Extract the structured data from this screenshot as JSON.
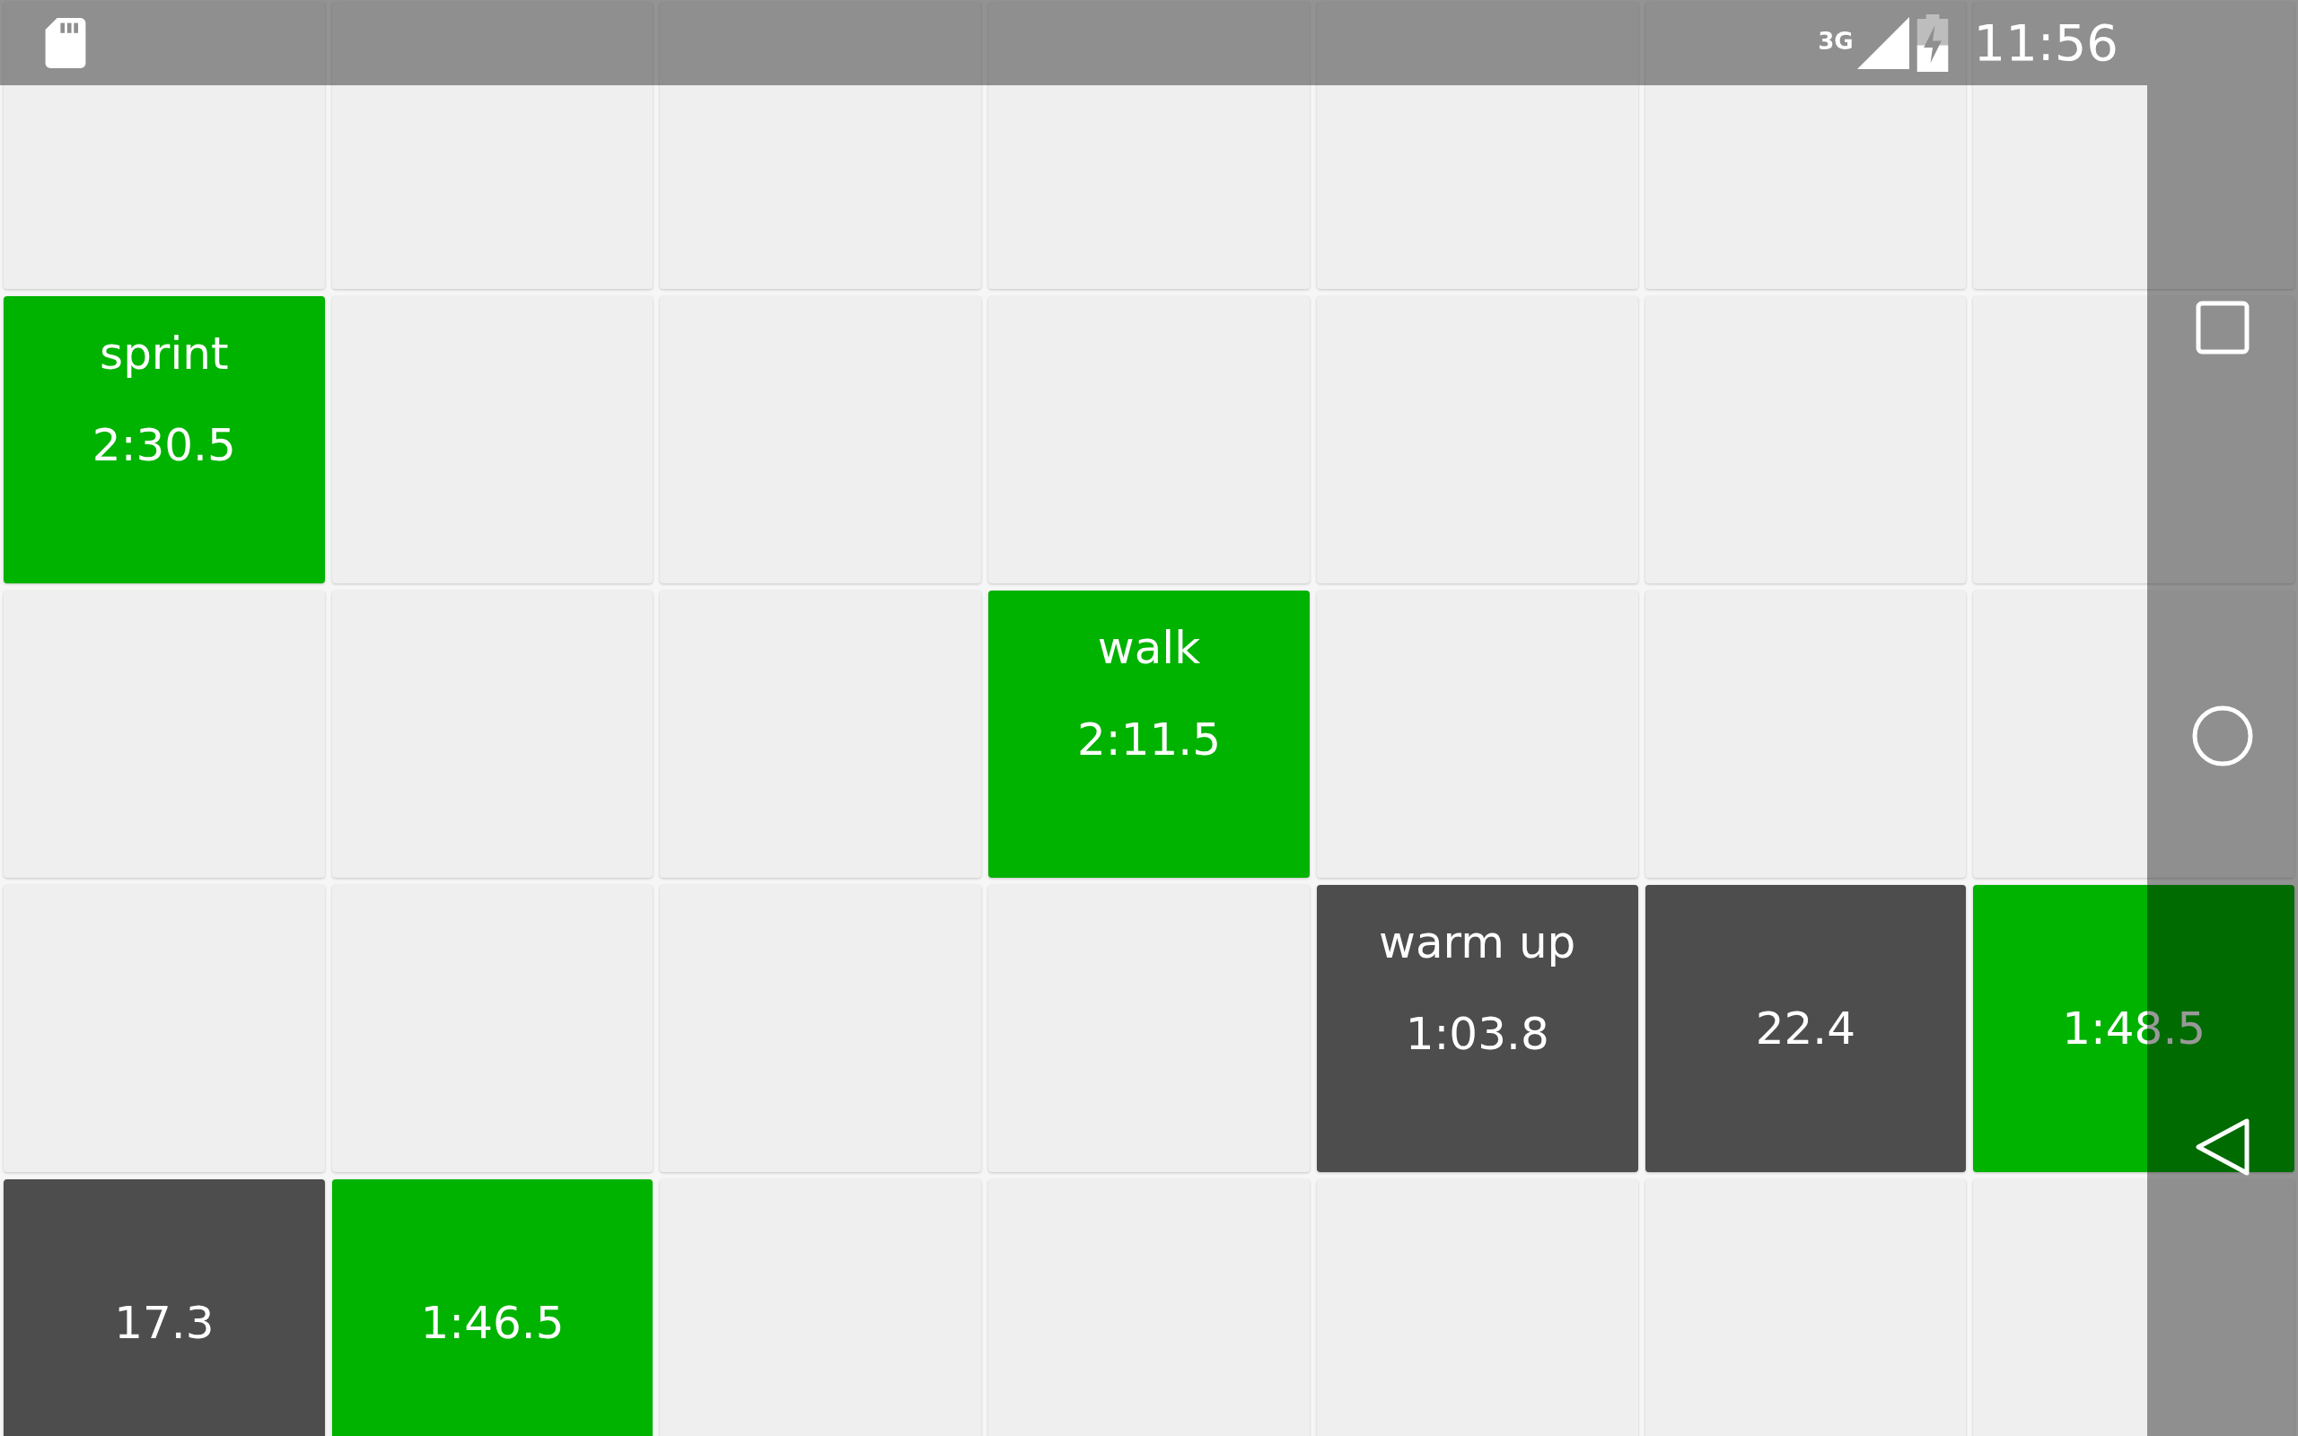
{
  "status_bar": {
    "network": "3G",
    "time": "11:56"
  },
  "grid": [
    [
      {
        "color": "#efefef"
      },
      {
        "color": "#efefef"
      },
      {
        "color": "#efefef"
      },
      {
        "color": "#efefef"
      },
      {
        "color": "#efefef"
      },
      {
        "color": "#efefef"
      },
      {
        "color": "#efefef"
      }
    ],
    [
      {
        "color": "#00b300",
        "label": "sprint",
        "time": "2:30.5"
      },
      {
        "color": "#efefef"
      },
      {
        "color": "#efefef"
      },
      {
        "color": "#efefef"
      },
      {
        "color": "#efefef"
      },
      {
        "color": "#efefef"
      },
      {
        "color": "#efefef"
      }
    ],
    [
      {
        "color": "#efefef"
      },
      {
        "color": "#efefef"
      },
      {
        "color": "#efefef"
      },
      {
        "color": "#00b300",
        "label": "walk",
        "time": "2:11.5"
      },
      {
        "color": "#efefef"
      },
      {
        "color": "#efefef"
      },
      {
        "color": "#efefef"
      }
    ],
    [
      {
        "color": "#efefef"
      },
      {
        "color": "#efefef"
      },
      {
        "color": "#efefef"
      },
      {
        "color": "#efefef"
      },
      {
        "color": "#4d4d4d",
        "label": "warm up",
        "time": "1:03.8"
      },
      {
        "color": "#4d4d4d",
        "time": "22.4"
      },
      {
        "color": "#00b300",
        "time": "1:48.5"
      }
    ],
    [
      {
        "color": "#4d4d4d",
        "time": "17.3"
      },
      {
        "color": "#00b300",
        "time": "1:46.5"
      },
      {
        "color": "#efefef"
      },
      {
        "color": "#efefef"
      },
      {
        "color": "#efefef"
      },
      {
        "color": "#efefef"
      },
      {
        "color": "#efefef"
      }
    ]
  ]
}
